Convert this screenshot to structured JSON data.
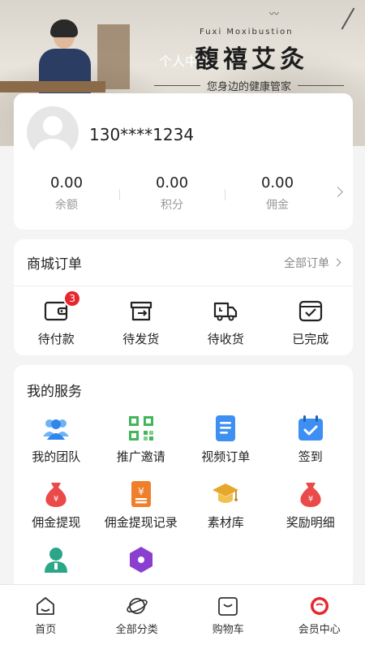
{
  "banner": {
    "page_title": "个人中心",
    "brand_en": "Fuxi Moxibustion",
    "brand_cn": "馥禧艾灸",
    "tagline": "您身边的健康管家"
  },
  "profile": {
    "phone": "130****1234",
    "stats": [
      {
        "value": "0.00",
        "label": "余额"
      },
      {
        "value": "0.00",
        "label": "积分"
      },
      {
        "value": "0.00",
        "label": "佣金"
      }
    ]
  },
  "orders": {
    "title": "商城订单",
    "all_label": "全部订单",
    "items": [
      {
        "label": "待付款",
        "icon": "wallet-icon",
        "badge": "3"
      },
      {
        "label": "待发货",
        "icon": "box-icon"
      },
      {
        "label": "待收货",
        "icon": "truck-icon"
      },
      {
        "label": "已完成",
        "icon": "check-box-icon"
      }
    ]
  },
  "services": {
    "title": "我的服务",
    "items": [
      {
        "label": "我的团队",
        "icon": "team-icon"
      },
      {
        "label": "推广邀请",
        "icon": "qrcode-icon"
      },
      {
        "label": "视频订单",
        "icon": "document-icon"
      },
      {
        "label": "签到",
        "icon": "calendar-check-icon"
      },
      {
        "label": "佣金提现",
        "icon": "money-bag-icon"
      },
      {
        "label": "佣金提现记录",
        "icon": "receipt-icon"
      },
      {
        "label": "素材库",
        "icon": "graduation-cap-icon"
      },
      {
        "label": "奖励明细",
        "icon": "reward-bag-icon"
      },
      {
        "label": "",
        "icon": "person-icon"
      },
      {
        "label": "",
        "icon": "hexagon-icon"
      }
    ]
  },
  "tabbar": {
    "items": [
      {
        "label": "首页",
        "icon": "home-icon"
      },
      {
        "label": "全部分类",
        "icon": "planet-icon"
      },
      {
        "label": "购物车",
        "icon": "cart-icon"
      },
      {
        "label": "会员中心",
        "icon": "member-icon",
        "active": true
      }
    ]
  },
  "colors": {
    "badge": "#e8262e",
    "member_active": "#e8262e",
    "service_blue": "#3d8ff2",
    "service_green": "#43b55a",
    "service_red": "#ea4a4a",
    "service_orange": "#f07f2c",
    "service_gold": "#e6a72b",
    "service_teal": "#2aa689",
    "service_purple": "#8a3fd1"
  }
}
